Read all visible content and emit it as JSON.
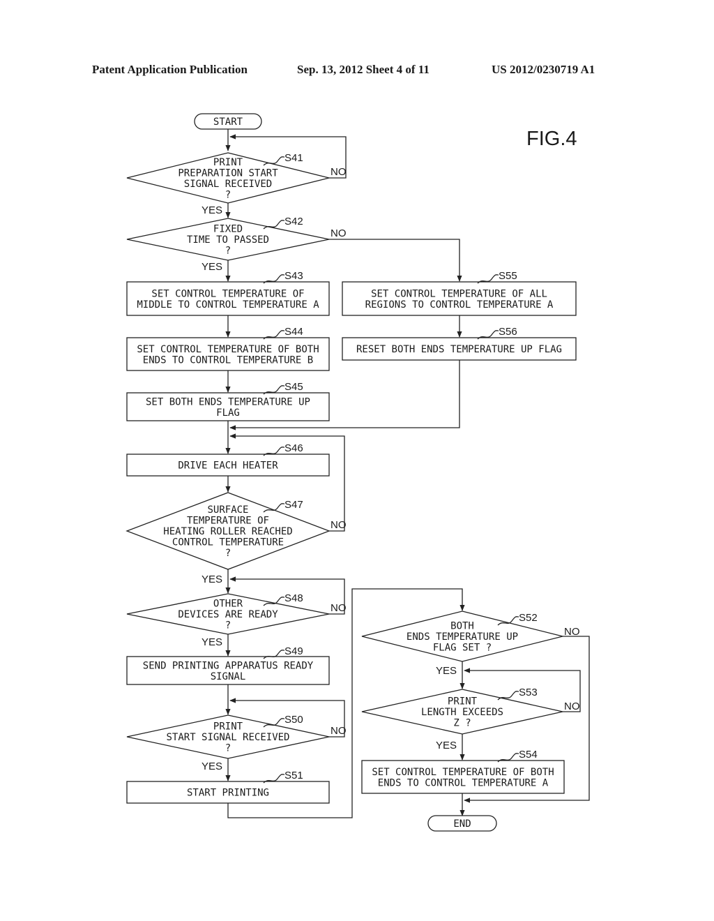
{
  "header": {
    "publication": "Patent Application Publication",
    "date_sheet": "Sep. 13, 2012   Sheet 4 of 11",
    "number": "US 2012/0230719 A1"
  },
  "figure_label": "FIG.4",
  "terminals": {
    "start": "START",
    "end": "END"
  },
  "branch_labels": {
    "yes": "YES",
    "no": "NO"
  },
  "steps": [
    {
      "id": "S41",
      "type": "decision",
      "lines": [
        "PRINT",
        "PREPARATION START",
        "SIGNAL RECEIVED",
        "?"
      ]
    },
    {
      "id": "S42",
      "type": "decision",
      "lines": [
        "FIXED",
        "TIME TO PASSED",
        "?"
      ]
    },
    {
      "id": "S43",
      "type": "process",
      "lines": [
        "SET CONTROL TEMPERATURE OF",
        "MIDDLE TO CONTROL TEMPERATURE A"
      ]
    },
    {
      "id": "S44",
      "type": "process",
      "lines": [
        "SET CONTROL TEMPERATURE OF BOTH",
        "ENDS TO CONTROL TEMPERATURE B"
      ]
    },
    {
      "id": "S45",
      "type": "process",
      "lines": [
        "SET BOTH ENDS TEMPERATURE UP",
        "FLAG"
      ]
    },
    {
      "id": "S46",
      "type": "process",
      "lines": [
        "DRIVE EACH HEATER"
      ]
    },
    {
      "id": "S47",
      "type": "decision",
      "lines": [
        "SURFACE",
        "TEMPERATURE OF",
        "HEATING ROLLER REACHED",
        "CONTROL TEMPERATURE",
        "?"
      ]
    },
    {
      "id": "S48",
      "type": "decision",
      "lines": [
        "OTHER",
        "DEVICES ARE READY",
        "?"
      ]
    },
    {
      "id": "S49",
      "type": "process",
      "lines": [
        "SEND PRINTING APPARATUS READY",
        "SIGNAL"
      ]
    },
    {
      "id": "S50",
      "type": "decision",
      "lines": [
        "PRINT",
        "START SIGNAL RECEIVED",
        "?"
      ]
    },
    {
      "id": "S51",
      "type": "process",
      "lines": [
        "START PRINTING"
      ]
    },
    {
      "id": "S52",
      "type": "decision",
      "lines": [
        "BOTH",
        "ENDS TEMPERATURE UP",
        "FLAG SET ?"
      ]
    },
    {
      "id": "S53",
      "type": "decision",
      "lines": [
        "PRINT",
        "LENGTH EXCEEDS",
        "Z ?"
      ]
    },
    {
      "id": "S54",
      "type": "process",
      "lines": [
        "SET CONTROL TEMPERATURE OF BOTH",
        "ENDS TO CONTROL TEMPERATURE A"
      ]
    },
    {
      "id": "S55",
      "type": "process",
      "lines": [
        "SET CONTROL TEMPERATURE OF ALL",
        "REGIONS TO CONTROL TEMPERATURE A"
      ]
    },
    {
      "id": "S56",
      "type": "process",
      "lines": [
        "RESET BOTH ENDS TEMPERATURE UP FLAG"
      ]
    }
  ]
}
